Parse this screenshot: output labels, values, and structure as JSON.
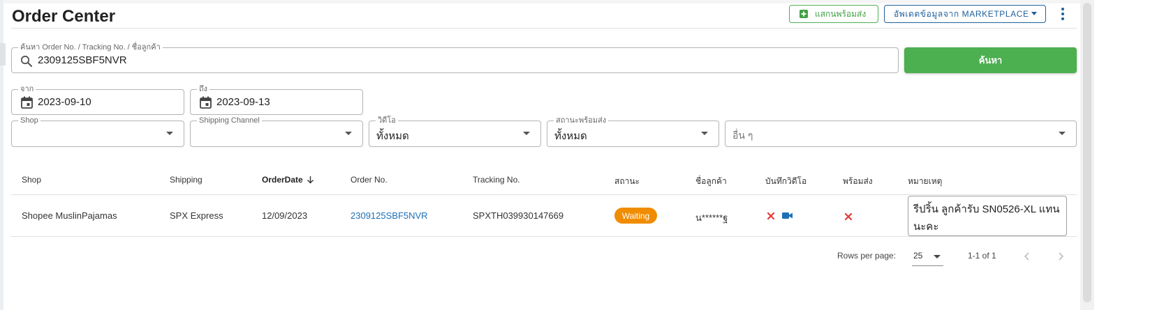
{
  "header": {
    "title": "Order Center",
    "scan_button": "แสกนพร้อมส่ง",
    "update_button": "อัพเดตข้อมูลจาก MARKETPLACE"
  },
  "search": {
    "label": "ค้นหา Order No. / Tracking No. / ชื่อลูกค้า",
    "value": "2309125SBF5NVR",
    "button": "ค้นหา"
  },
  "filters": {
    "date_from": {
      "label": "จาก",
      "value": "2023-09-10"
    },
    "date_to": {
      "label": "ถึง",
      "value": "2023-09-13"
    },
    "shop": {
      "label": "Shop",
      "value": ""
    },
    "shipping_channel": {
      "label": "Shipping Channel",
      "value": ""
    },
    "video": {
      "label": "วิดีโอ",
      "value": "ทั้งหมด"
    },
    "ready_status": {
      "label": "สถานะพร้อมส่ง",
      "value": "ทั้งหมด"
    },
    "other": {
      "placeholder": "อื่น ๆ"
    }
  },
  "table": {
    "headers": {
      "shop": "Shop",
      "shipping": "Shipping",
      "order_date": "OrderDate",
      "order_no": "Order No.",
      "tracking_no": "Tracking No.",
      "status": "สถานะ",
      "customer": "ชื่อลูกค้า",
      "video_record": "บันทึกวิดีโอ",
      "ready": "พร้อมส่ง",
      "note": "หมายเหตุ"
    },
    "rows": [
      {
        "shop": "Shopee MuslinPajamas",
        "shipping": "SPX Express",
        "order_date": "12/09/2023",
        "order_no": "2309125SBF5NVR",
        "tracking_no": "SPXTH039930147669",
        "status": "Waiting",
        "customer": "น******ฐ",
        "note": "รีปริ้น ลูกค้ารับ  SN0526-XL แทนนะคะ"
      }
    ]
  },
  "pagination": {
    "rows_per_page_label": "Rows per page:",
    "rows_per_page": "25",
    "range": "1-1 of 1"
  },
  "colors": {
    "primary_green": "#4caf50",
    "primary_blue": "#1e5f9b",
    "link_blue": "#1e6fb5",
    "status_orange": "#f08c00",
    "error_red": "#e53935"
  },
  "icons": {
    "scan": "add-box-icon",
    "search": "search-icon",
    "calendar": "calendar-icon",
    "sort": "arrow-down-icon",
    "video": "videocam-icon",
    "close": "close-icon"
  }
}
